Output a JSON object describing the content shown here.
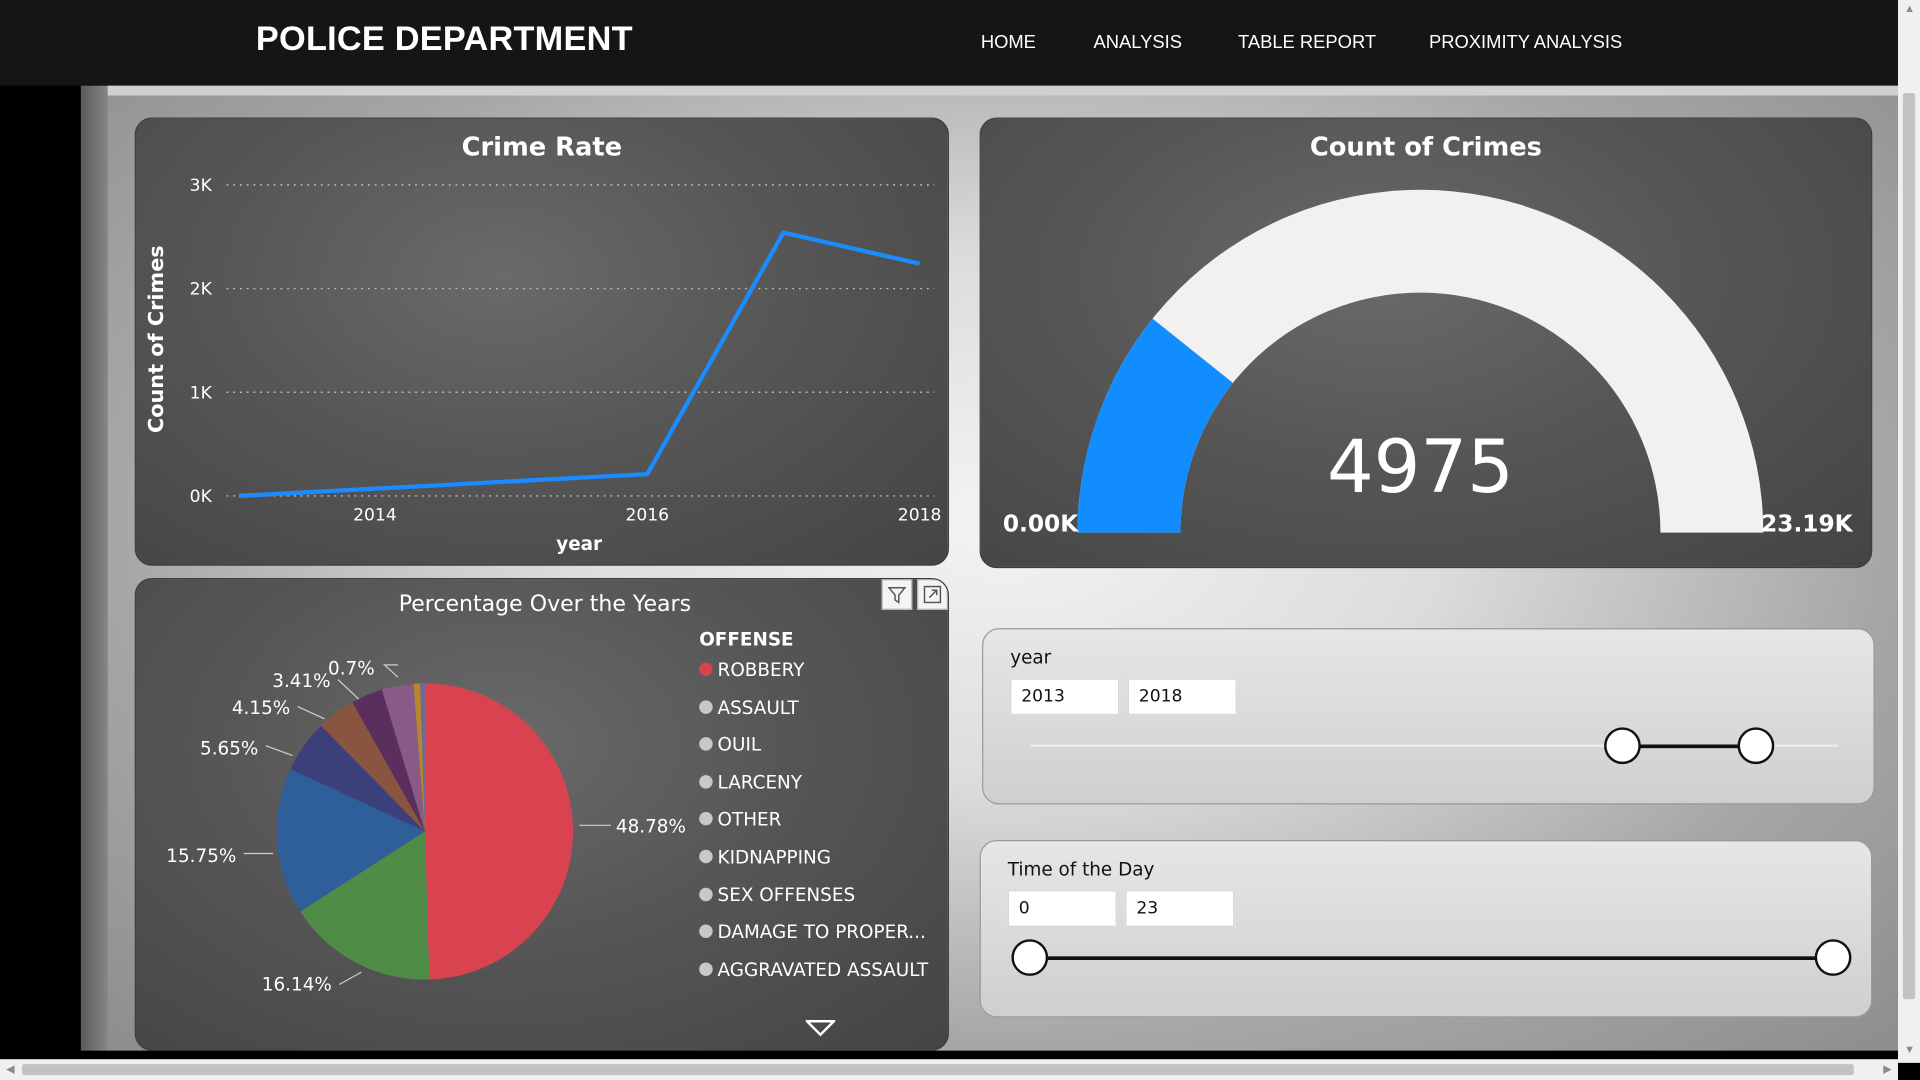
{
  "header": {
    "title": "POLICE DEPARTMENT",
    "nav": [
      "HOME",
      "ANALYSIS",
      "TABLE REPORT",
      "PROXIMITY ANALYSIS"
    ]
  },
  "crime_rate": {
    "title": "Crime Rate",
    "ylabel": "Count of Crimes",
    "xlabel": "year",
    "y_ticks": [
      "3K",
      "2K",
      "1K",
      "0K"
    ],
    "x_ticks": [
      "2014",
      "2016",
      "2018"
    ],
    "line_color": "#1a8cff"
  },
  "gauge": {
    "title": "Count of Crimes",
    "value_label": "4975",
    "min_label": "0.00K",
    "max_label": "23.19K",
    "fill_color": "#118dff",
    "track_color": "#f2f1ef"
  },
  "pie": {
    "title": "Percentage Over the Years",
    "legend_title": "OFFENSE",
    "legend": [
      "ROBBERY",
      "ASSAULT",
      "OUIL",
      "LARCENY",
      "OTHER",
      "KIDNAPPING",
      "SEX OFFENSES",
      "DAMAGE TO PROPER...",
      "AGGRAVATED ASSAULT"
    ],
    "labels": [
      "48.78%",
      "16.14%",
      "15.75%",
      "5.65%",
      "4.15%",
      "3.41%",
      "0.7%"
    ]
  },
  "year_slicer": {
    "label": "year",
    "from": "2013",
    "to": "2018"
  },
  "time_slicer": {
    "label": "Time of the Day",
    "from": "0",
    "to": "23"
  },
  "chart_data": [
    {
      "type": "line",
      "title": "Crime Rate",
      "xlabel": "year",
      "ylabel": "Count of Crimes",
      "x": [
        2013,
        2016,
        2017,
        2018
      ],
      "y": [
        0,
        210,
        2540,
        2240
      ],
      "xlim": [
        2013,
        2018
      ],
      "ylim": [
        0,
        3000
      ],
      "grid": true
    },
    {
      "type": "gauge",
      "title": "Count of Crimes",
      "value": 4975,
      "min": 0,
      "max": 23190
    },
    {
      "type": "pie",
      "title": "Percentage Over the Years",
      "legend_title": "OFFENSE",
      "categories": [
        "ROBBERY",
        "ASSAULT",
        "OUIL",
        "LARCENY",
        "OTHER",
        "KIDNAPPING",
        "SEX OFFENSES",
        "DAMAGE TO PROPER...",
        "AGGRAVATED ASSAULT"
      ],
      "values": [
        48.78,
        16.14,
        15.75,
        5.65,
        4.15,
        3.41,
        3.41,
        0.7,
        0.5
      ],
      "colors": [
        "#d9434f",
        "#4f8c45",
        "#2e5f9a",
        "#3b3f7a",
        "#8a5540",
        "#5a2f5e",
        "#8a5a87",
        "#b8862e",
        "#6b6b9a"
      ]
    }
  ]
}
